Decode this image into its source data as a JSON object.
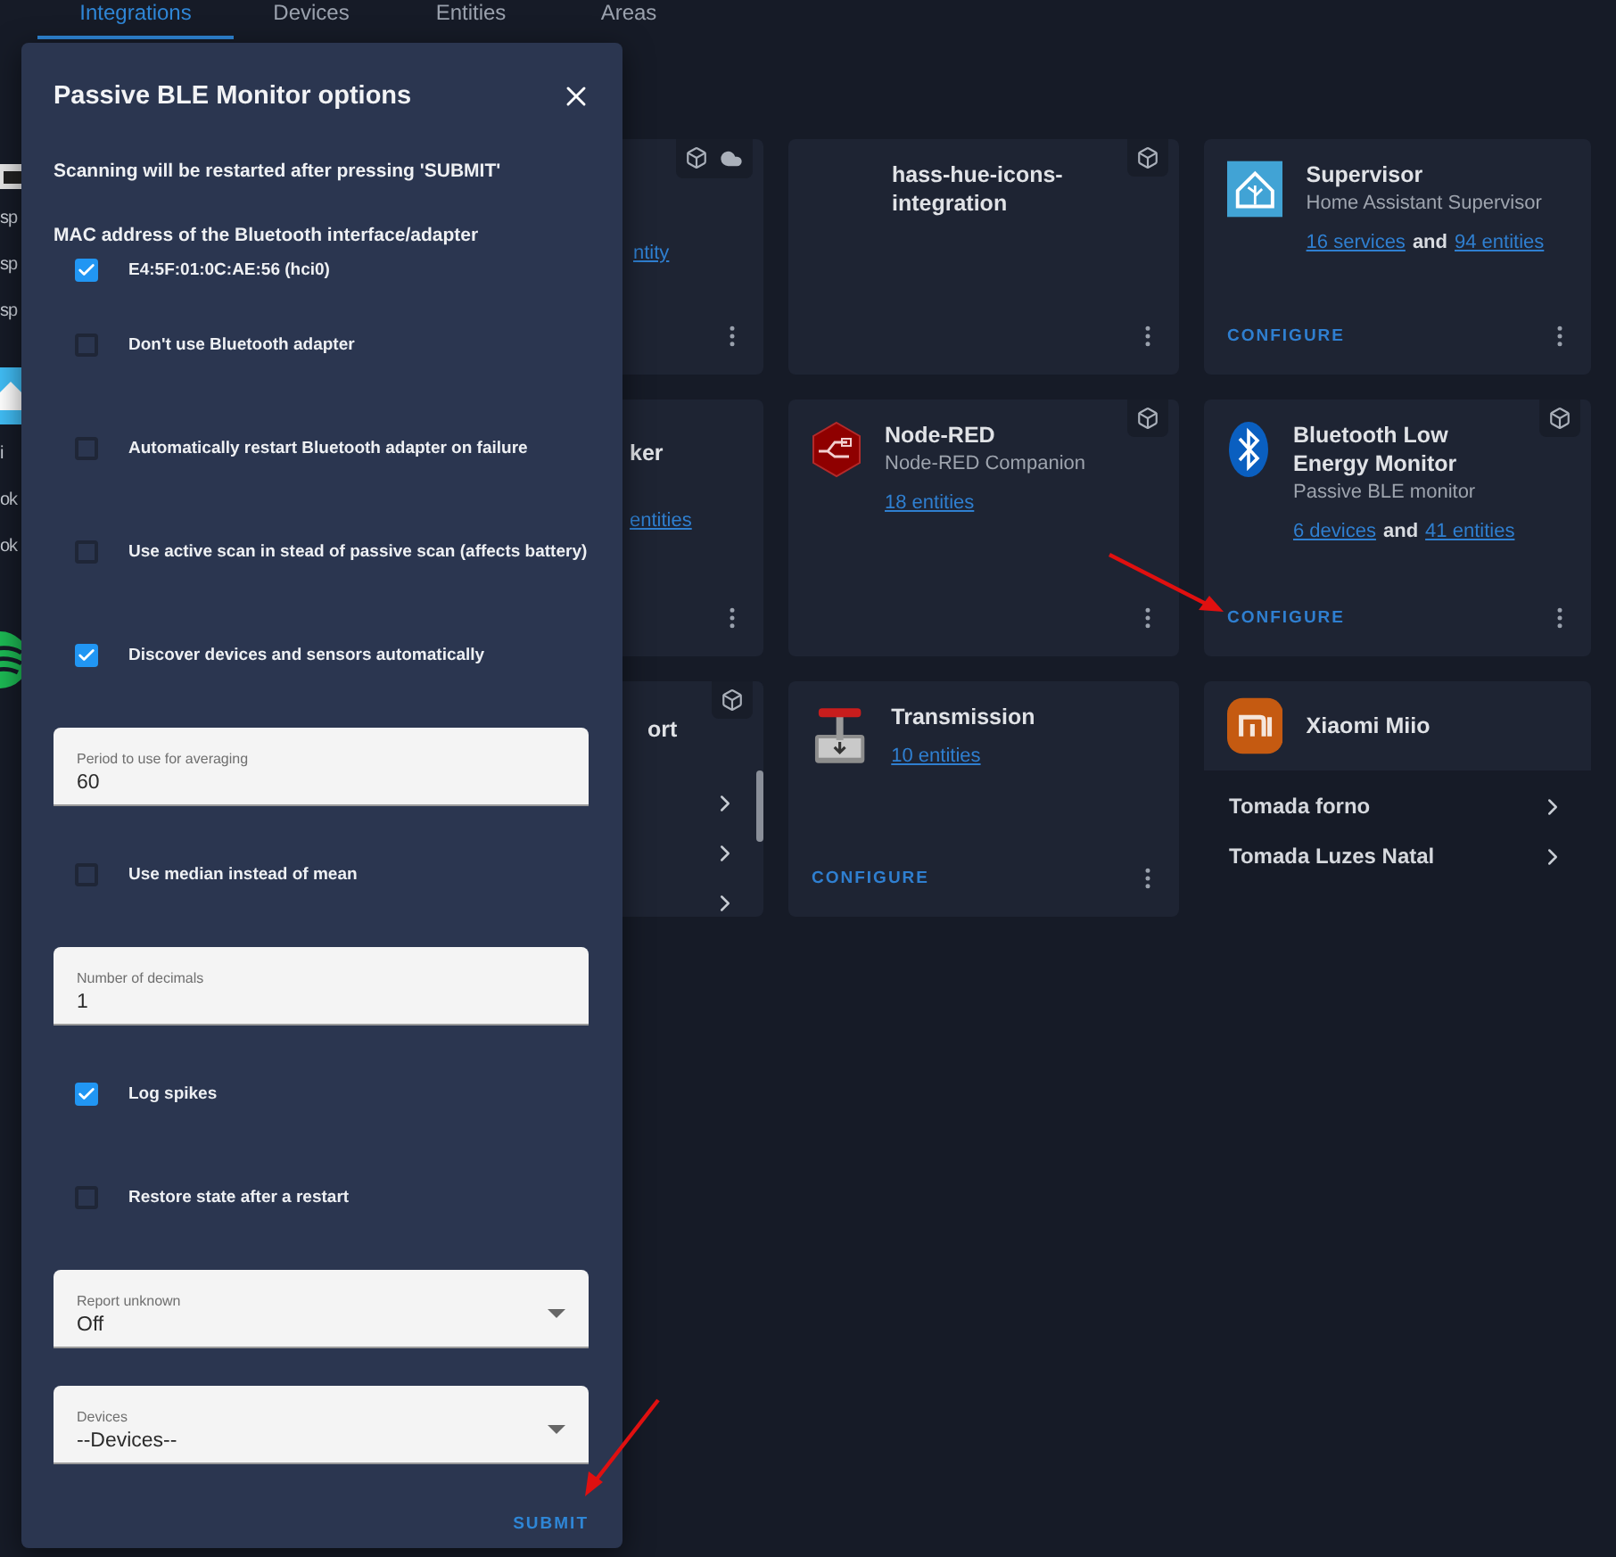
{
  "tabs": [
    {
      "label": "Integrations",
      "selected": true
    },
    {
      "label": "Devices",
      "selected": false
    },
    {
      "label": "Entities",
      "selected": false
    },
    {
      "label": "Areas",
      "selected": false
    }
  ],
  "edge_fragments": [
    {
      "kind": "icon"
    },
    {
      "kind": "text",
      "text": "sp"
    },
    {
      "kind": "text",
      "text": "sp"
    },
    {
      "kind": "text",
      "text": "sp"
    },
    {
      "kind": "icon"
    },
    {
      "kind": "text",
      "text": "i"
    },
    {
      "kind": "text",
      "text": "ok"
    },
    {
      "kind": "text",
      "text": "ok"
    },
    {
      "kind": "icon"
    }
  ],
  "cards": [
    {
      "links": [
        "ntity"
      ]
    },
    {
      "title": "hass-hue-icons-integration"
    },
    {
      "title": "Supervisor",
      "subtitle": "Home Assistant Supervisor",
      "links": [
        "16 services",
        "94 entities"
      ],
      "joiner": "and",
      "action": "CONFIGURE"
    },
    {
      "title": "ker",
      "links": [
        "entities"
      ]
    },
    {
      "title": "Node-RED",
      "subtitle": "Node-RED Companion",
      "links": [
        "18 entities"
      ]
    },
    {
      "title": "Bluetooth Low Energy Monitor",
      "subtitle": "Passive BLE monitor",
      "links": [
        "6 devices",
        "41 entities"
      ],
      "joiner": "and",
      "action": "CONFIGURE"
    },
    {
      "title": "ort",
      "list": [
        {
          "kind": "row"
        },
        {
          "kind": "row"
        },
        {
          "kind": "row"
        }
      ]
    },
    {
      "title": "Transmission",
      "links": [
        "10 entities"
      ],
      "action": "CONFIGURE"
    },
    {
      "title": "Xiaomi Miio",
      "list": [
        {
          "kind": "row",
          "label": "Tomada forno"
        },
        {
          "kind": "row",
          "label": "Tomada Luzes Natal"
        }
      ]
    }
  ],
  "dialog": {
    "title": "Passive BLE Monitor options",
    "note": "Scanning will be restarted after pressing 'SUBMIT'",
    "section_label": "MAC address of the Bluetooth interface/adapter",
    "fields": [
      {
        "kind": "checkbox",
        "label": "E4:5F:01:0C:AE:56 (hci0)",
        "checked": true
      },
      {
        "kind": "checkbox",
        "label": "Don't use Bluetooth adapter",
        "checked": false
      },
      {
        "kind": "checkbox",
        "label": "Automatically restart Bluetooth adapter on failure",
        "checked": false
      },
      {
        "kind": "checkbox",
        "label": "Use active scan in stead of passive scan (affects battery)",
        "checked": false
      },
      {
        "kind": "checkbox",
        "label": "Discover devices and sensors automatically",
        "checked": true
      },
      {
        "kind": "text",
        "label": "Period to use for averaging",
        "value": "60"
      },
      {
        "kind": "checkbox",
        "label": "Use median instead of mean",
        "checked": false
      },
      {
        "kind": "text",
        "label": "Number of decimals",
        "value": "1"
      },
      {
        "kind": "checkbox",
        "label": "Log spikes",
        "checked": true
      },
      {
        "kind": "checkbox",
        "label": "Restore state after a restart",
        "checked": false
      },
      {
        "kind": "select",
        "label": "Report unknown",
        "value": "Off"
      },
      {
        "kind": "select",
        "label": "Devices",
        "value": "--Devices--"
      }
    ],
    "submit": "SUBMIT"
  }
}
